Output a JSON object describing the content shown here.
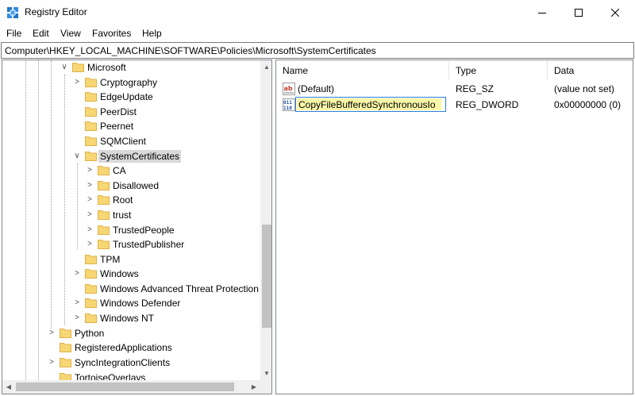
{
  "window": {
    "title": "Registry Editor"
  },
  "menu": [
    "File",
    "Edit",
    "View",
    "Favorites",
    "Help"
  ],
  "address": "Computer\\HKEY_LOCAL_MACHINE\\SOFTWARE\\Policies\\Microsoft\\SystemCertificates",
  "tree": {
    "microsoft": "Microsoft",
    "cryptography": "Cryptography",
    "edgeupdate": "EdgeUpdate",
    "peerdist": "PeerDist",
    "peernet": "Peernet",
    "sqmclient": "SQMClient",
    "systemcertificates": "SystemCertificates",
    "ca": "CA",
    "disallowed": "Disallowed",
    "root": "Root",
    "trust": "trust",
    "trustedpeople": "TrustedPeople",
    "trustedpublisher": "TrustedPublisher",
    "tpm": "TPM",
    "windows": "Windows",
    "windows_atp": "Windows Advanced Threat Protection",
    "windows_defender": "Windows Defender",
    "windows_nt": "Windows NT",
    "python": "Python",
    "registeredapplications": "RegisteredApplications",
    "syncintegrationclients": "SyncIntegrationClients",
    "tortoiseoverlays": "TortoiseOverlays"
  },
  "list": {
    "columns": {
      "name": "Name",
      "type": "Type",
      "data": "Data"
    },
    "rows": [
      {
        "name": "(Default)",
        "type": "REG_SZ",
        "data": "(value not set)"
      },
      {
        "name": "CopyFileBufferedSynchronousIo",
        "type": "REG_DWORD",
        "data": "0x00000000 (0)"
      }
    ]
  },
  "colors": {
    "folder": "#f7d674",
    "folder_dark": "#e0b24a",
    "selection": "#d9d9d9",
    "rename_bg": "#fbf6a7",
    "rename_border": "#2d7fd8"
  },
  "icons": {
    "app": "registry-editor-icon",
    "string_value": "string-value-icon",
    "dword_value": "dword-value-icon",
    "folder": "folder-icon"
  }
}
